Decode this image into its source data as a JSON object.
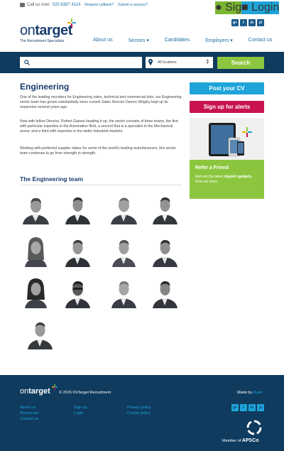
{
  "topbar": {
    "call_label": "Call us now:",
    "phone": "020 8397 4114",
    "request_callback": "Request callback?",
    "submit_vacancy": "Submit a vacancy?",
    "signup": "Sign up",
    "login": "Login"
  },
  "brand": {
    "logo_on": "on",
    "logo_target": "target",
    "tagline": "The Recruitment Specialists",
    "accent": "#1ea4d9",
    "navy": "#0e3b5e",
    "green": "#8cc63f",
    "pink": "#c8134f"
  },
  "social": [
    "g+",
    "t",
    "in",
    "yt"
  ],
  "nav": [
    "About us",
    "Sectors ▾",
    "Candidates",
    "Employers ▾",
    "Contact us"
  ],
  "search": {
    "placeholder": "",
    "location": "All locations",
    "button": "Search"
  },
  "page": {
    "title": "Engineering",
    "p1": "One of the leading recruiters for Engineering sales, technical and commercial jobs, our Engineering sector team has grown substantially since current Sales Director Darren Wrigley kept up its expansion several years ago.",
    "p2": "Now with fellow Director, Robert Gaines heading it up, the sector consists of three teams, the first with particular expertise in the Automation field, a second that is a specialist in the Mechanical arena; and a third with expertise in the wider Industrial markets.",
    "p3": "Working with preferred supplier status for some of the world's leading manufacturers, this sector team continues to go from strength to strength.",
    "team_title": "The Engineering team"
  },
  "sidebar": {
    "post_cv": "Post your CV",
    "alerts": "Sign up for alerts",
    "refer_title": "Refer a Friend",
    "refer_text_a": "And win the latest ",
    "refer_text_b": "Apple® gadgets",
    "refer_text_c": ". Find out more."
  },
  "footer": {
    "logo_on": "on",
    "logo_target": "target",
    "copyright": "© 2015 OnTarget Recruitment",
    "made_by": "Made by ",
    "made_by_link": "Ryan",
    "col1": [
      "About us",
      "Resources",
      "Contact us"
    ],
    "col2": [
      "Sign up",
      "Login"
    ],
    "col3": [
      "Privacy policy",
      "Cookie policy"
    ],
    "member_of": "Member of ",
    "apsco": "APSCo"
  }
}
